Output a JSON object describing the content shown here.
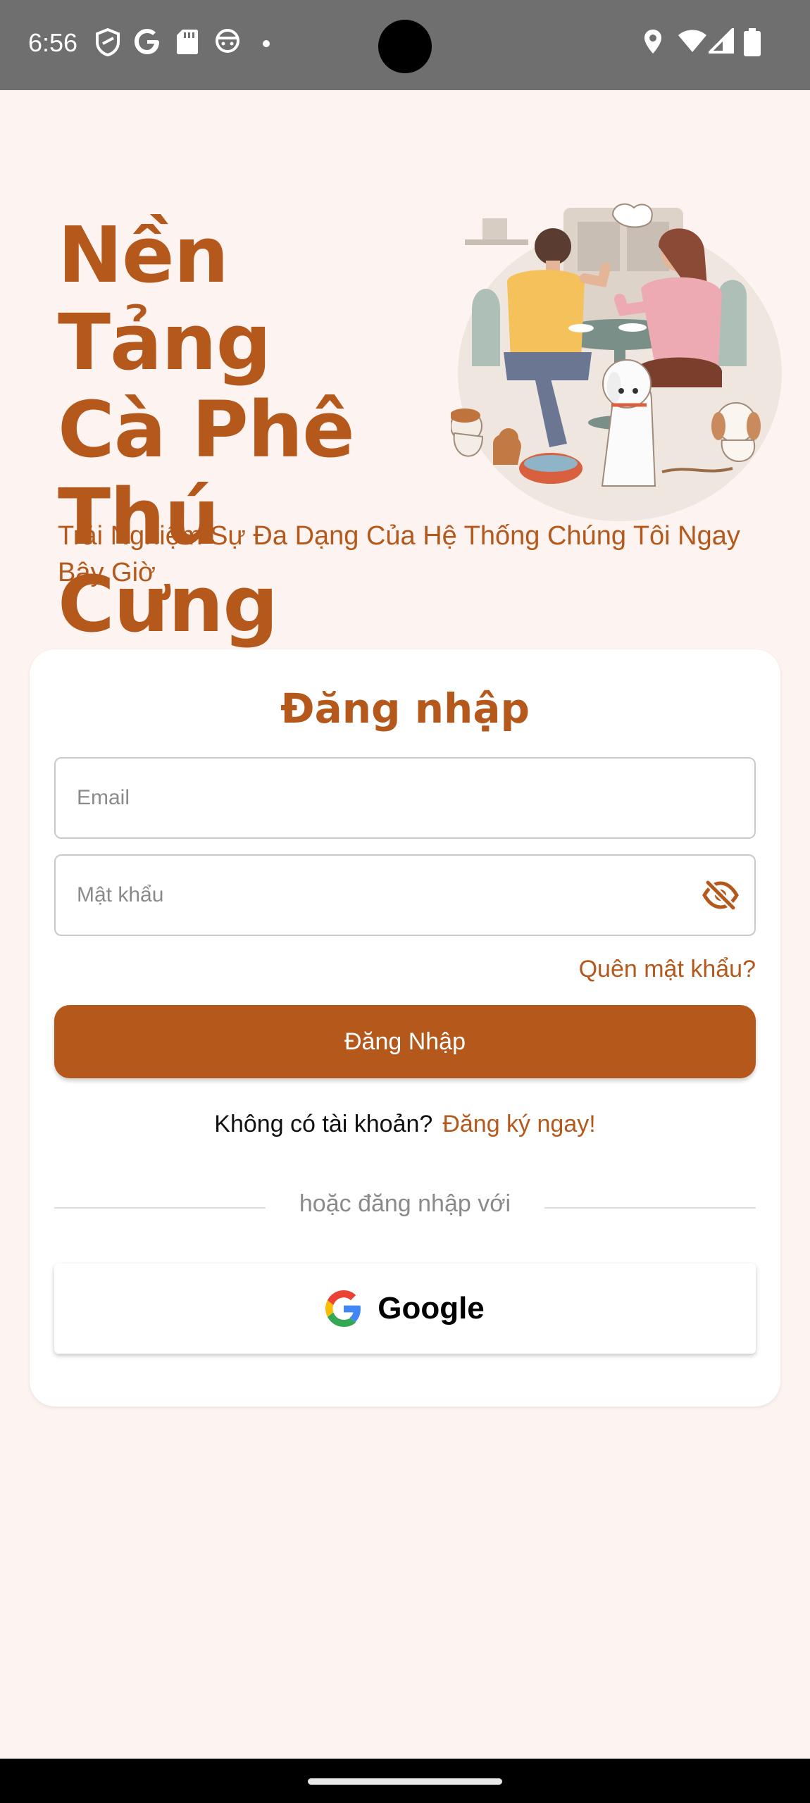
{
  "status_bar": {
    "time": "6:56",
    "left_icons": [
      "shield-icon",
      "google-g-icon",
      "sd-card-icon",
      "smiley-icon",
      "dot-icon"
    ],
    "right_icons": [
      "location-icon",
      "wifi-icon",
      "signal-icon",
      "battery-icon"
    ]
  },
  "hero": {
    "title_line1": "Nền Tảng",
    "title_line2": "Cà Phê",
    "title_line3": "Thú Cưng",
    "subtitle": "Trải Nghiệm Sự Đa Dạng Của Hệ Thống Chúng Tôi Ngay Bây Giờ",
    "illustration": "pet-cafe-illustration"
  },
  "login": {
    "title": "Đăng nhập",
    "email_placeholder": "Email",
    "email_value": "",
    "password_placeholder": "Mật khẩu",
    "password_value": "",
    "forgot_label": "Quên mật khẩu?",
    "login_button": "Đăng Nhập",
    "no_account_text": "Không có tài khoản?",
    "signup_link": "Đăng ký ngay!",
    "divider_text": "hoặc đăng nhập với",
    "google_label": "Google"
  },
  "colors": {
    "accent": "#b5581b",
    "background": "#fdf4f1",
    "status_bar": "#6f6f6f",
    "card": "#ffffff"
  }
}
